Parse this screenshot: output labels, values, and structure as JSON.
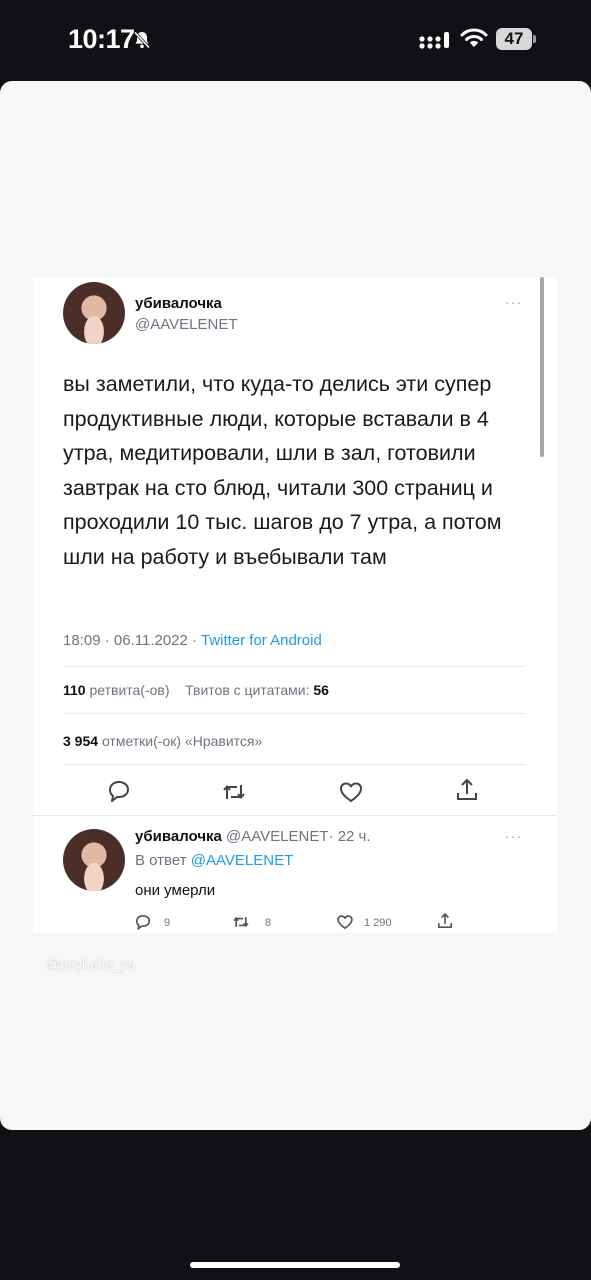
{
  "status_bar": {
    "time": "10:17",
    "battery": "47",
    "icons": [
      "bell-off-icon",
      "signal-icon",
      "wifi-icon",
      "battery-icon"
    ]
  },
  "tweet": {
    "author_name": "убивалочка",
    "author_handle": "@AAVELENET",
    "text": "вы заметили, что куда-то делись эти супер продуктивные люди, которые вставали в 4 утра, медитировали, шли в зал, готовили завтрак на сто блюд, читали 300 страниц и проходили 10 тыс. шагов до 7 утра, а потом шли на работу и въебывали там",
    "time": "18:09",
    "date": "06.11.2022",
    "source": "Twitter for Android",
    "separator": "·",
    "retweets_count": "110",
    "retweets_label": "ретвита(-ов)",
    "quotes_label": "Твитов с цитатами:",
    "quotes_count": "56",
    "likes_count": "3 954",
    "likes_label": "отметки(-ок) «Нравится»",
    "more": "···"
  },
  "reply": {
    "author_name": "убивалочка",
    "author_handle": "@AAVELENET",
    "age": "· 22 ч.",
    "reply_to_label": "В ответ",
    "reply_to_handle": "@AAVELENET",
    "text": "они умерли",
    "replies": "9",
    "retweets": "8",
    "likes": "1 290",
    "more": "···"
  },
  "watermark": "@psyhehe_ya",
  "colors": {
    "background": "#0f1115",
    "sheet": "#f7f7f8",
    "link": "#1d9bf0",
    "muted": "#6b7580"
  }
}
